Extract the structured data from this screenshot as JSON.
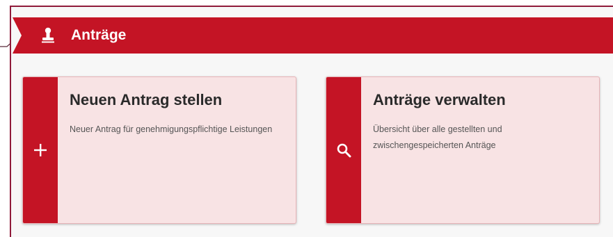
{
  "header": {
    "title": "Anträge",
    "icon": "stamp-icon"
  },
  "cards": [
    {
      "title": "Neuen Antrag stellen",
      "description": "Neuer Antrag für genehmigungspflichtige Leistungen",
      "icon": "plus-icon"
    },
    {
      "title": "Anträge verwalten",
      "description": "Übersicht über alle gestellten und zwischengespeicherten Anträge",
      "icon": "search-icon"
    }
  ],
  "colors": {
    "brand_red": "#c41425",
    "card_background": "#f8e3e4",
    "frame_border": "#8f1a3a"
  }
}
